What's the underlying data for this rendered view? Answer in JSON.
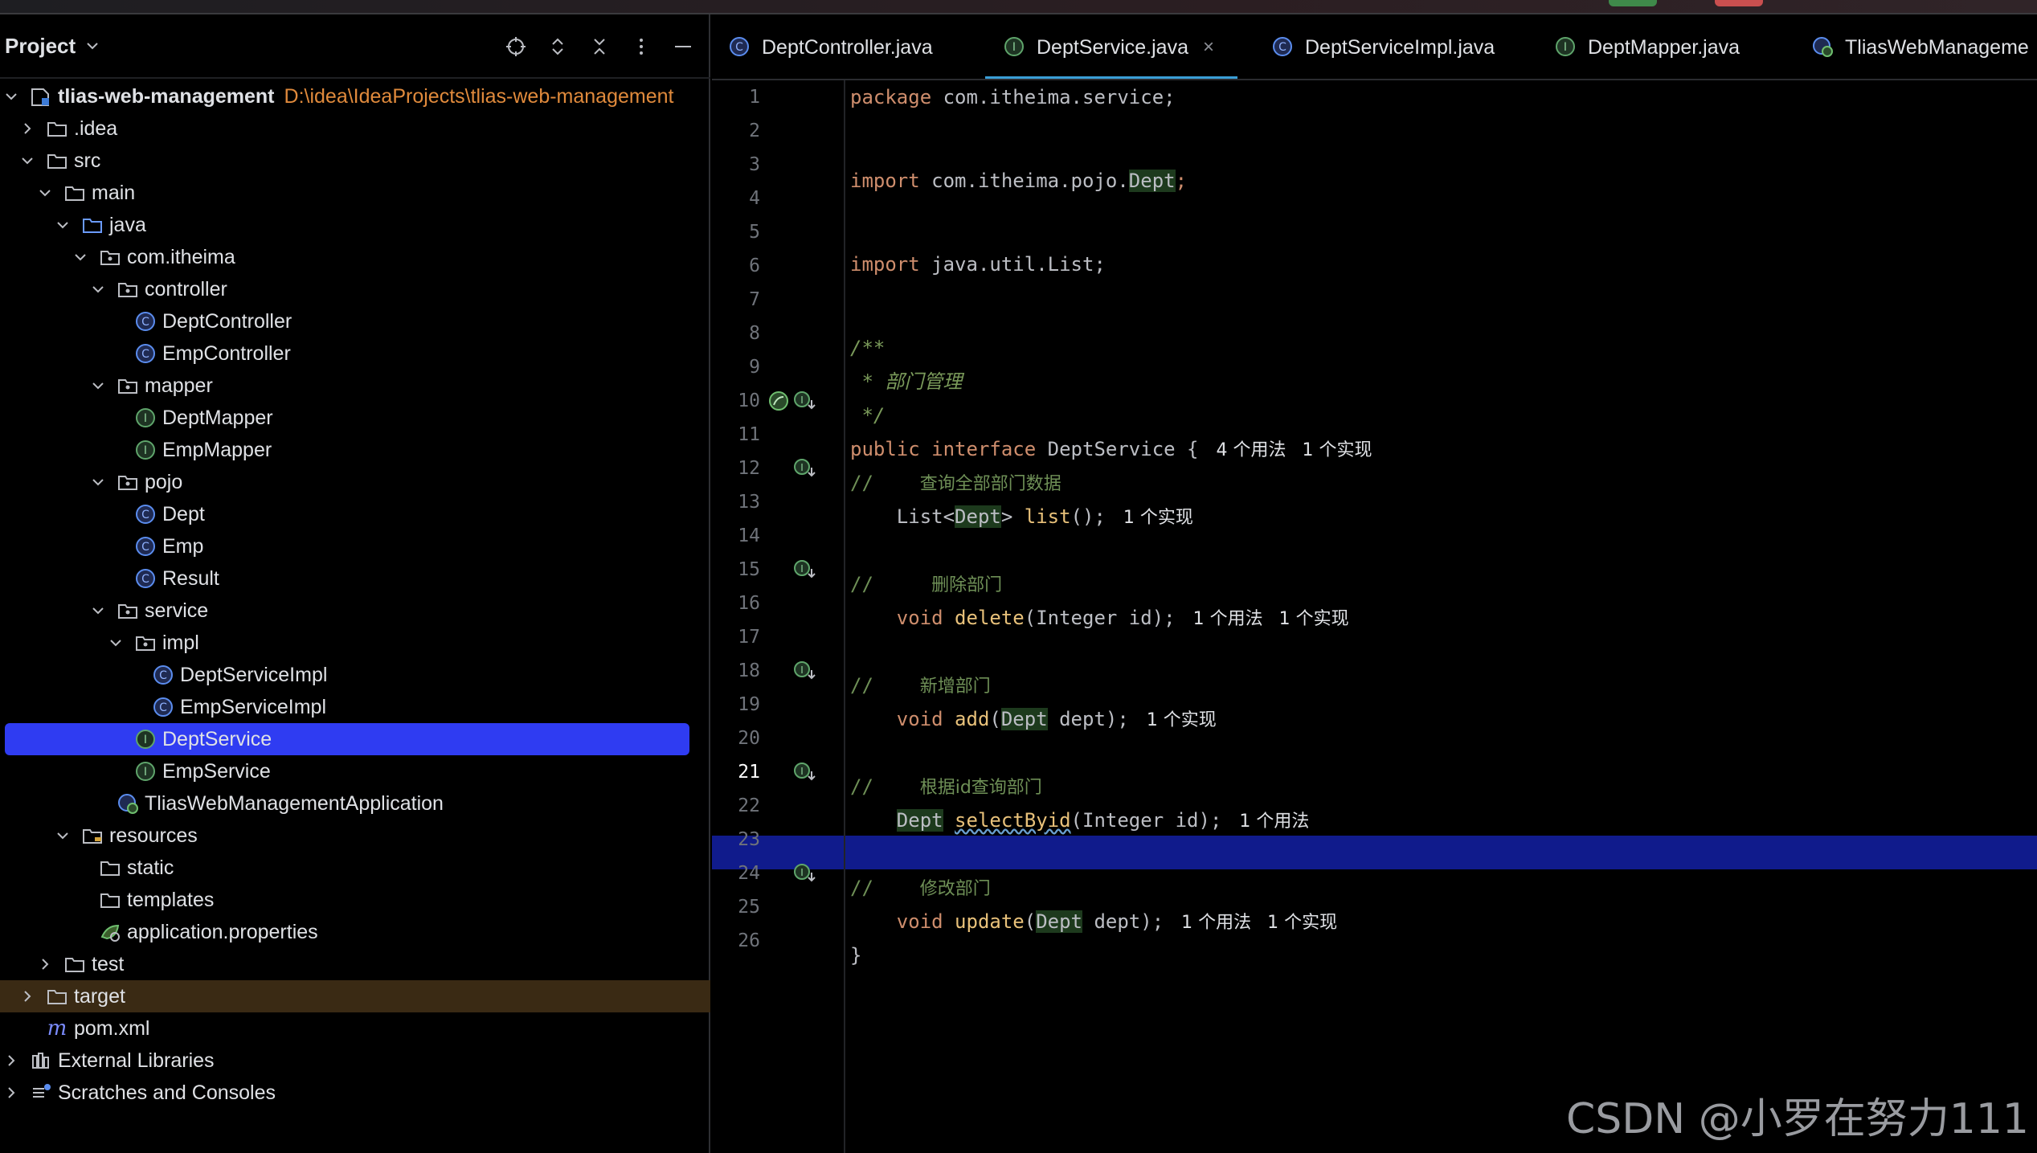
{
  "project_panel": {
    "title": "Project",
    "tools": [
      "locate-icon",
      "expand-icon",
      "collapse-icon",
      "more-icon",
      "minimize-icon"
    ]
  },
  "tree": [
    {
      "label": "tlias-web-management",
      "path": "D:\\idea\\IdeaProjects\\tlias-web-management",
      "icon": "module-icon",
      "expanded": true,
      "bold": true
    },
    {
      "label": ".idea",
      "icon": "folder-icon",
      "expanded": false
    },
    {
      "label": "src",
      "icon": "folder-icon",
      "expanded": true
    },
    {
      "label": "main",
      "icon": "folder-icon",
      "expanded": true
    },
    {
      "label": "java",
      "icon": "source-folder-icon",
      "expanded": true
    },
    {
      "label": "com.itheima",
      "icon": "package-icon",
      "expanded": true
    },
    {
      "label": "controller",
      "icon": "package-icon",
      "expanded": true
    },
    {
      "label": "DeptController",
      "icon": "class-icon"
    },
    {
      "label": "EmpController",
      "icon": "class-icon"
    },
    {
      "label": "mapper",
      "icon": "package-icon",
      "expanded": true
    },
    {
      "label": "DeptMapper",
      "icon": "interface-icon"
    },
    {
      "label": "EmpMapper",
      "icon": "interface-icon"
    },
    {
      "label": "pojo",
      "icon": "package-icon",
      "expanded": true
    },
    {
      "label": "Dept",
      "icon": "class-icon"
    },
    {
      "label": "Emp",
      "icon": "class-icon"
    },
    {
      "label": "Result",
      "icon": "class-icon"
    },
    {
      "label": "service",
      "icon": "package-icon",
      "expanded": true
    },
    {
      "label": "impl",
      "icon": "package-icon",
      "expanded": true
    },
    {
      "label": "DeptServiceImpl",
      "icon": "class-icon"
    },
    {
      "label": "EmpServiceImpl",
      "icon": "class-icon"
    },
    {
      "label": "DeptService",
      "icon": "interface-icon",
      "selected": true
    },
    {
      "label": "EmpService",
      "icon": "interface-icon"
    },
    {
      "label": "TliasWebManagementApplication",
      "icon": "spring-app-icon"
    },
    {
      "label": "resources",
      "icon": "resources-folder-icon",
      "expanded": true
    },
    {
      "label": "static",
      "icon": "folder-icon"
    },
    {
      "label": "templates",
      "icon": "folder-icon"
    },
    {
      "label": "application.properties",
      "icon": "properties-icon"
    },
    {
      "label": "test",
      "icon": "folder-icon",
      "expanded": false
    },
    {
      "label": "target",
      "icon": "folder-icon",
      "expanded": false,
      "excluded": true
    },
    {
      "label": "pom.xml",
      "icon": "maven-icon"
    },
    {
      "label": "External Libraries",
      "icon": "libraries-icon",
      "expanded": false
    },
    {
      "label": "Scratches and Consoles",
      "icon": "scratches-icon",
      "expanded": false
    }
  ],
  "tabs": [
    {
      "label": "DeptController.java",
      "icon": "class-icon"
    },
    {
      "label": "DeptService.java",
      "icon": "interface-icon",
      "active": true,
      "close": "×"
    },
    {
      "label": "DeptServiceImpl.java",
      "icon": "class-icon"
    },
    {
      "label": "DeptMapper.java",
      "icon": "interface-icon"
    },
    {
      "label": "TliasWebManageme",
      "icon": "spring-app-icon"
    }
  ],
  "editor": {
    "current_line": 21,
    "line_numbers": [
      "1",
      "2",
      "3",
      "4",
      "5",
      "6",
      "7",
      "8",
      "9",
      "10",
      "11",
      "12",
      "13",
      "14",
      "15",
      "16",
      "17",
      "18",
      "19",
      "20",
      "21",
      "22",
      "23",
      "24",
      "25",
      "26"
    ],
    "code": {
      "l1_kw": "package",
      "l1_rest": " com.itheima.service;",
      "l3_kw": "import",
      "l3_pre": " com.itheima.pojo.",
      "l3_cls": "Dept",
      "l3_semi": ";",
      "l5_kw": "import",
      "l5_rest": " java.util.List;",
      "l7": "/**",
      "l8": " * 部门管理",
      "l9": " */",
      "l10_kw1": "public",
      "l10_kw2": "interface",
      "l10_name": "DeptService",
      "l10_brace": " {",
      "l10_hint1": "4 个用法",
      "l10_hint2": "1 个实现",
      "l11_sl": "//",
      "l11_zh": "查询全部部门数据",
      "l12_a": "List<",
      "l12_cls": "Dept",
      "l12_b": "> ",
      "l12_fn": "list",
      "l12_c": "();",
      "l12_hint": "1 个实现",
      "l14_sl": "//",
      "l14_zh": "删除部门",
      "l15_kw": "void",
      "l15_fn": "delete",
      "l15_args": "(Integer id);",
      "l15_hint1": "1 个用法",
      "l15_hint2": "1 个实现",
      "l17_sl": "//",
      "l17_zh": "新增部门",
      "l18_kw": "void",
      "l18_fn": "add",
      "l18_a": "(",
      "l18_cls": "Dept",
      "l18_b": " dept);",
      "l18_hint": "1 个实现",
      "l20_sl": "//",
      "l20_zh": "根据id查询部门",
      "l21_cls": "Dept",
      "l21_fn": "selectByid",
      "l21_args": "(Integer id);",
      "l21_hint": "1 个用法",
      "l23_sl": "//",
      "l23_zh": "修改部门",
      "l24_kw": "void",
      "l24_fn": "update",
      "l24_a": "(",
      "l24_cls": "Dept",
      "l24_b": " dept);",
      "l24_hint1": "1 个用法",
      "l24_hint2": "1 个实现",
      "l25": "}"
    }
  },
  "watermark": "CSDN @小罗在努力111",
  "colors": {
    "selection": "#2f3cf2",
    "current_line": "#101b8c",
    "keyword": "#cf8e6d",
    "method": "#56a8f5",
    "comment": "#6e8f56",
    "path": "#e08a3c",
    "tab_underline": "#3a9ed6"
  }
}
